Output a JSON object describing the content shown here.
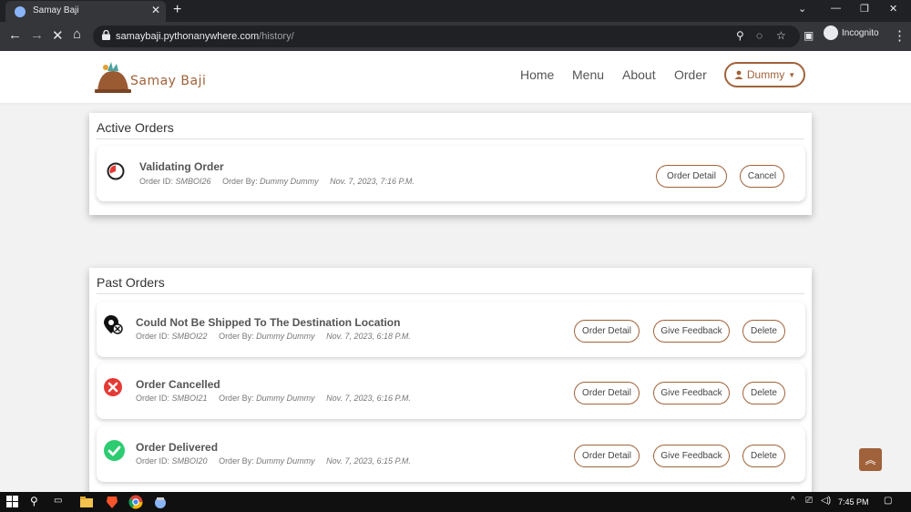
{
  "browser": {
    "tab_title": "Samay Baji",
    "url_host": "samaybaji.pythonanywhere.com",
    "url_path": "/history/",
    "profile_label": "Incognito"
  },
  "navbar": {
    "brand": "Samay Baji",
    "links": [
      "Home",
      "Menu",
      "About",
      "Order"
    ],
    "user_label": "Dummy"
  },
  "active": {
    "title": "Active Orders",
    "orders": [
      {
        "status": "Validating Order",
        "order_id_label": "Order ID:",
        "order_id": "SMBOI26",
        "order_by_label": "Order By:",
        "order_by": "Dummy Dummy",
        "date": "Nov. 7, 2023, 7:16 P.M.",
        "icon": "pending-clock-icon",
        "buttons": [
          "Order Detail",
          "Cancel"
        ]
      }
    ]
  },
  "past": {
    "title": "Past Orders",
    "orders": [
      {
        "status": "Could Not Be Shipped To The Destination Location",
        "order_id_label": "Order ID:",
        "order_id": "SMBOI22",
        "order_by_label": "Order By:",
        "order_by": "Dummy Dummy",
        "date": "Nov. 7, 2023, 6:18 P.M.",
        "icon": "location-off-icon",
        "buttons": [
          "Order Detail",
          "Give Feedback",
          "Delete"
        ]
      },
      {
        "status": "Order Cancelled",
        "order_id_label": "Order ID:",
        "order_id": "SMBOI21",
        "order_by_label": "Order By:",
        "order_by": "Dummy Dummy",
        "date": "Nov. 7, 2023, 6:16 P.M.",
        "icon": "cancelled-x-icon",
        "buttons": [
          "Order Detail",
          "Give Feedback",
          "Delete"
        ]
      },
      {
        "status": "Order Delivered",
        "order_id_label": "Order ID:",
        "order_id": "SMBOI20",
        "order_by_label": "Order By:",
        "order_by": "Dummy Dummy",
        "date": "Nov. 7, 2023, 6:15 P.M.",
        "icon": "delivered-check-icon",
        "buttons": [
          "Order Detail",
          "Give Feedback",
          "Delete"
        ]
      }
    ]
  },
  "taskbar": {
    "clock": "7:45 PM"
  },
  "colors": {
    "accent": "#a0623a",
    "cancelled": "#e53935",
    "delivered": "#2ecc71"
  }
}
